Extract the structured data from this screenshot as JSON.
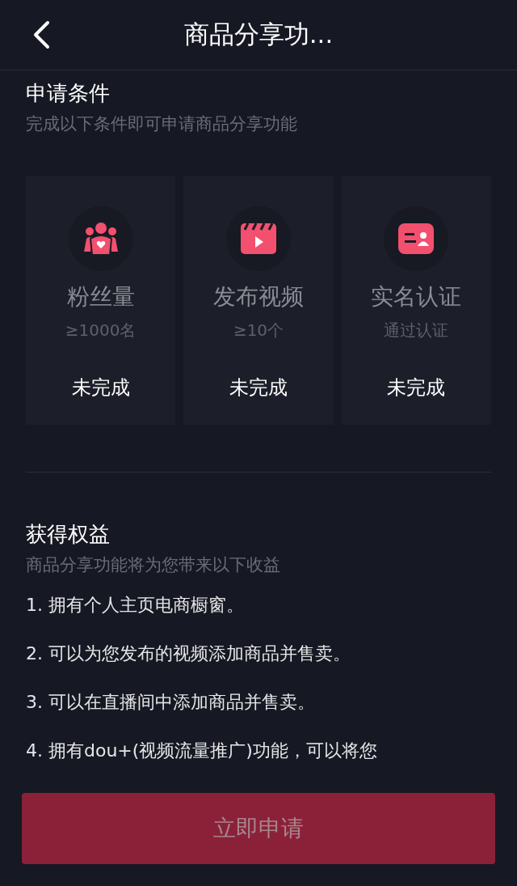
{
  "header": {
    "title": "商品分享功..."
  },
  "requirements": {
    "title": "申请条件",
    "subtitle": "完成以下条件即可申请商品分享功能",
    "items": [
      {
        "kind": "fans",
        "name": "粉丝量",
        "requirement": "≥1000名",
        "status": "未完成"
      },
      {
        "kind": "video",
        "name": "发布视频",
        "requirement": "≥10个",
        "status": "未完成"
      },
      {
        "kind": "identity",
        "name": "实名认证",
        "requirement": "通过认证",
        "status": "未完成"
      }
    ]
  },
  "benefits": {
    "title": "获得权益",
    "subtitle": "商品分享功能将为您带来以下收益",
    "items": [
      "1. 拥有个人主页电商橱窗。",
      "2. 可以为您发布的视频添加商品并售卖。",
      "3. 可以在直播间中添加商品并售卖。",
      "4. 拥有dou+(视频流量推广)功能，可以将您"
    ]
  },
  "apply_button": {
    "label": "立即申请",
    "disabled": true
  }
}
